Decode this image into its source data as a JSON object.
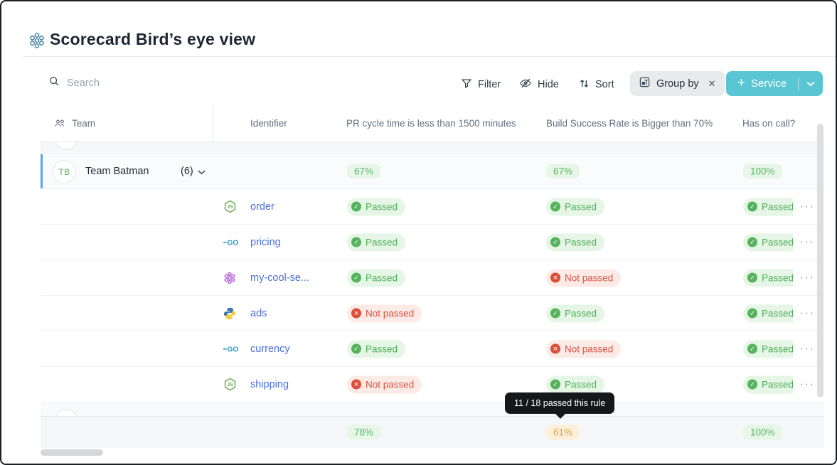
{
  "header": {
    "title": "Scorecard Bird’s eye view"
  },
  "toolbar": {
    "search_placeholder": "Search",
    "filter": "Filter",
    "hide": "Hide",
    "sort": "Sort",
    "group_by": "Group by",
    "service": "Service"
  },
  "columns": {
    "team": "Team",
    "identifier": "Identifier",
    "rule1": "PR cycle time is less than 1500 minutes",
    "rule2": "Build Success Rate is Bigger than 70%",
    "rule3": "Has on call?"
  },
  "group": {
    "avatar_initials": "TB",
    "name": "Team Batman",
    "count": "(6)",
    "summary": [
      {
        "value": "67%",
        "tone": "green"
      },
      {
        "value": "67%",
        "tone": "green"
      },
      {
        "value": "100%",
        "tone": "green"
      }
    ]
  },
  "badge_labels": {
    "passed": "Passed",
    "not_passed": "Not passed"
  },
  "rows": [
    {
      "identifier": "order",
      "icon": "nodejs-icon",
      "cells": [
        "passed",
        "passed",
        "passed"
      ]
    },
    {
      "identifier": "pricing",
      "icon": "go-icon",
      "cells": [
        "passed",
        "passed",
        "passed"
      ]
    },
    {
      "identifier": "my-cool-se...",
      "icon": "cluster-purple-icon",
      "cells": [
        "passed",
        "not_passed",
        "passed"
      ]
    },
    {
      "identifier": "ads",
      "icon": "python-icon",
      "cells": [
        "not_passed",
        "passed",
        "passed"
      ]
    },
    {
      "identifier": "currency",
      "icon": "go-icon",
      "cells": [
        "passed",
        "not_passed",
        "passed"
      ]
    },
    {
      "identifier": "shipping",
      "icon": "nodejs-icon",
      "cells": [
        "not_passed",
        "passed",
        "passed"
      ]
    }
  ],
  "bottom_summary": [
    {
      "value": "78%",
      "tone": "green"
    },
    {
      "value": "61%",
      "tone": "orange"
    },
    {
      "value": "100%",
      "tone": "green"
    }
  ],
  "tooltip": {
    "text": "11 / 18 passed this rule"
  },
  "colors": {
    "accent_teal": "#5AC6D4",
    "pass_green": "#4CAE55",
    "fail_red": "#DC5342",
    "warn_orange": "#DFA143",
    "link_blue": "#4A6FDC",
    "selected_bar_blue": "#58A6E8"
  }
}
